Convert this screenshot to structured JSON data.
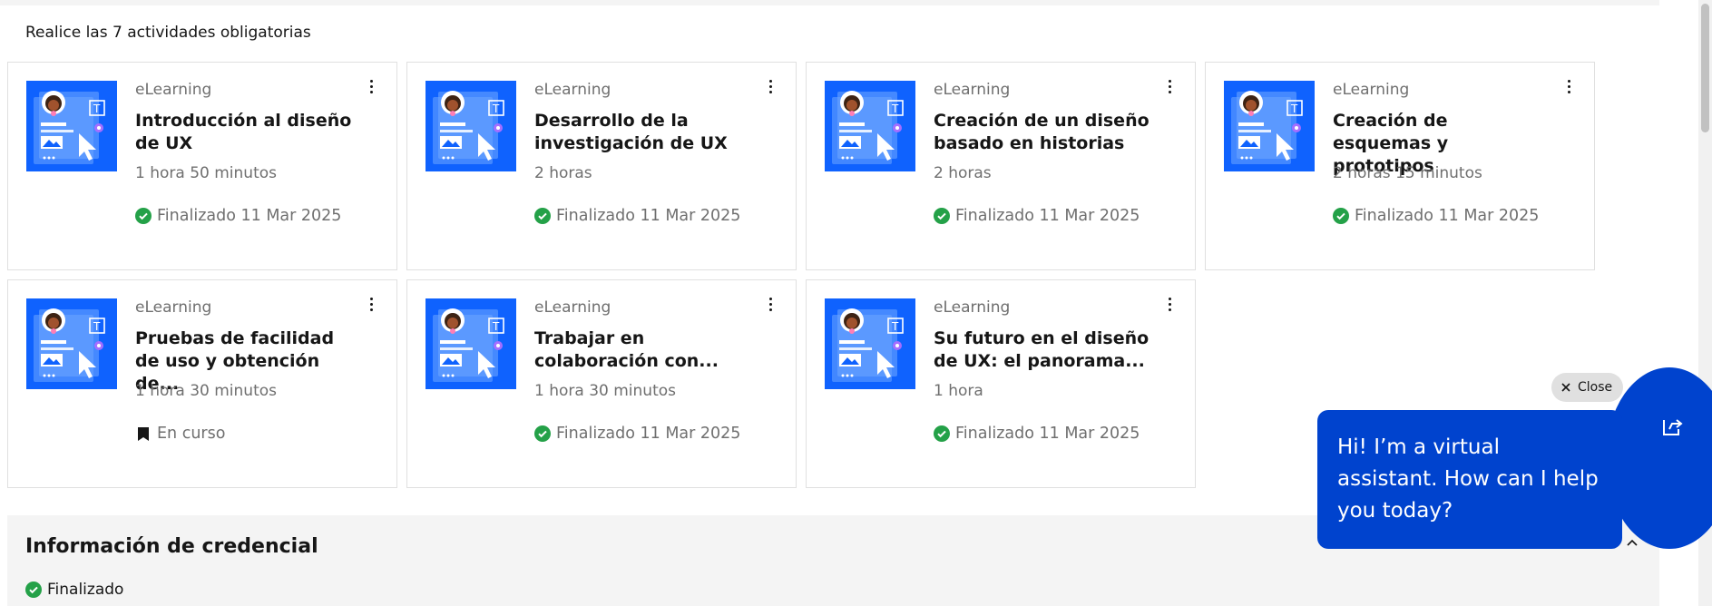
{
  "header": {
    "heading": "Realice las 7 actividades obligatorias"
  },
  "courses": [
    {
      "type": "eLearning",
      "title": "Introducción al diseño de UX",
      "duration": "1 hora 50 minutos",
      "status": "Finalizado 11 Mar 2025",
      "status_kind": "done"
    },
    {
      "type": "eLearning",
      "title": "Desarrollo de la investigación de UX",
      "duration": "2 horas",
      "status": "Finalizado 11 Mar 2025",
      "status_kind": "done"
    },
    {
      "type": "eLearning",
      "title": "Creación de un diseño basado en historias",
      "duration": "2 horas",
      "status": "Finalizado 11 Mar 2025",
      "status_kind": "done"
    },
    {
      "type": "eLearning",
      "title": "Creación de esquemas y prototipos",
      "duration": "2 horas 15 minutos",
      "status": "Finalizado 11 Mar 2025",
      "status_kind": "done"
    },
    {
      "type": "eLearning",
      "title": "Pruebas de facilidad de uso y obtención de...",
      "duration": "1 hora 30 minutos",
      "status": "En curso",
      "status_kind": "progress"
    },
    {
      "type": "eLearning",
      "title": "Trabajar en colaboración con...",
      "duration": "1 hora 30 minutos",
      "status": "Finalizado 11 Mar 2025",
      "status_kind": "done"
    },
    {
      "type": "eLearning",
      "title": "Su futuro en el diseño de UX: el panorama...",
      "duration": "1 hora",
      "status": "Finalizado 11 Mar 2025",
      "status_kind": "done"
    }
  ],
  "credential": {
    "title": "Información de credencial",
    "status": "Finalizado"
  },
  "chat": {
    "close_label": "Close",
    "greeting": "Hi! I’m a virtual assistant. How can I help you today?"
  },
  "colors": {
    "accent": "#0f62fe",
    "chat_blue": "#0043ce",
    "success": "#24a148"
  },
  "icons": {
    "card_menu": "overflow-menu-vertical-icon",
    "done": "checkmark-filled-icon",
    "progress": "bookmark-icon",
    "chat_launch": "launch-icon",
    "close": "close-icon",
    "collapse": "chevron-up-icon"
  }
}
